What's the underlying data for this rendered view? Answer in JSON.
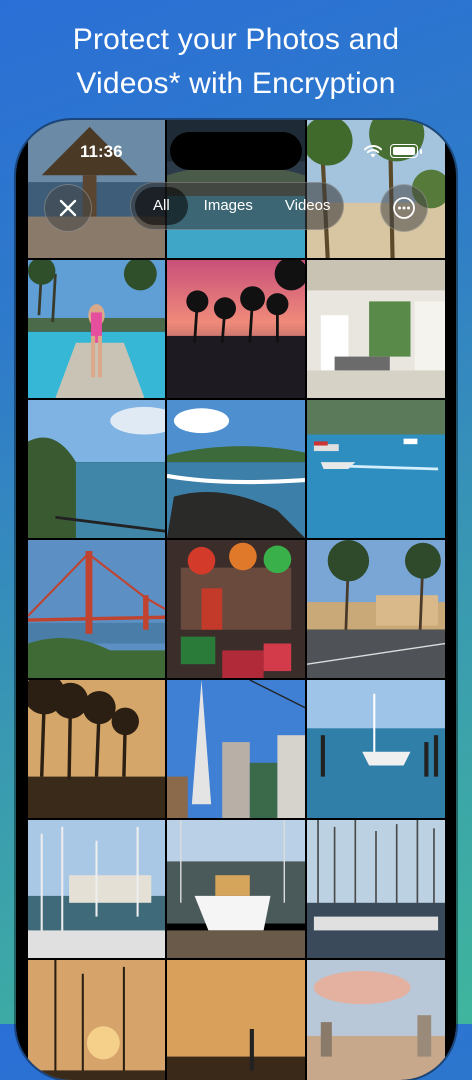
{
  "headline": {
    "line1": "Protect your Photos and",
    "line2": "Videos* with Encryption"
  },
  "status_bar": {
    "time": "11:36"
  },
  "toolbar": {
    "close_icon": "xmark-icon",
    "more_icon": "ellipsis-circle-icon",
    "filters": [
      {
        "label": "All",
        "selected": true
      },
      {
        "label": "Images",
        "selected": false
      },
      {
        "label": "Videos",
        "selected": false
      }
    ]
  },
  "photos": [
    "beach-hut-top",
    "pool-top",
    "palm-beach-top",
    "woman-pool",
    "sunset-palms",
    "cabana-interior",
    "coastal-cliffs",
    "rocky-shore-waves",
    "speedboats-bay",
    "golden-gate-bridge",
    "market-stall",
    "palm-boulevard-building",
    "palm-street-sunset",
    "transamerica-city",
    "harbor-boat-pilings",
    "marina-pier",
    "white-boat-marina",
    "marina-masts",
    "sailboats-sunset",
    "harbor-dusk",
    "city-skyline-sunset"
  ]
}
